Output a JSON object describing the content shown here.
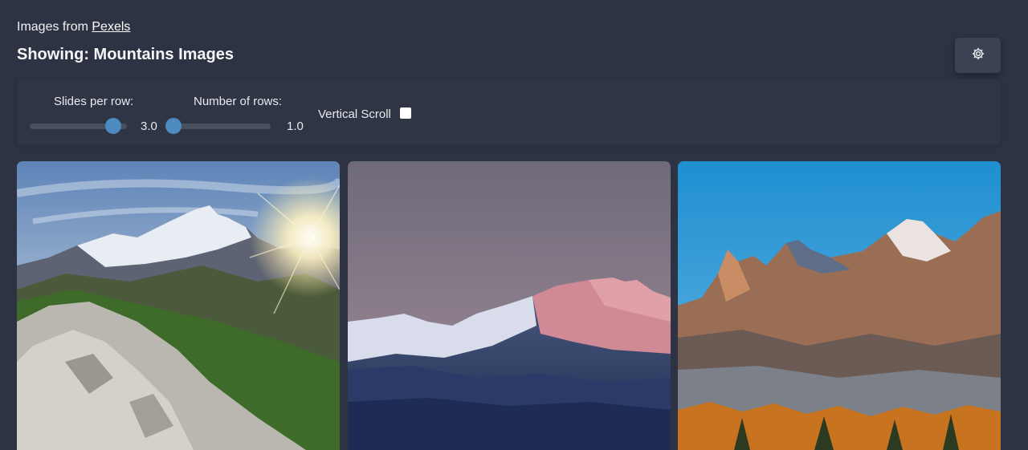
{
  "header": {
    "credit_prefix": "Images from",
    "credit_link": "Pexels",
    "title": "Showing: Mountains Images"
  },
  "settings": {
    "icon": "gear-icon"
  },
  "controls": {
    "slides_per_row": {
      "label": "Slides per row:",
      "value": "3.0",
      "level": 0.86
    },
    "number_of_rows": {
      "label": "Number of rows:",
      "value": "1.0",
      "level": 0.0
    },
    "vertical_scroll": {
      "label": "Vertical Scroll",
      "checked": false
    }
  },
  "gallery": {
    "images": [
      {
        "subject": "sunlit rocky mountain ridge with starburst sun"
      },
      {
        "subject": "snow-covered peaks at dusk with pink alpenglow"
      },
      {
        "subject": "jagged rocky peaks under blue sky with autumn trees"
      }
    ]
  },
  "colors": {
    "background": "#2d3343",
    "accent": "#4d8ac0"
  }
}
